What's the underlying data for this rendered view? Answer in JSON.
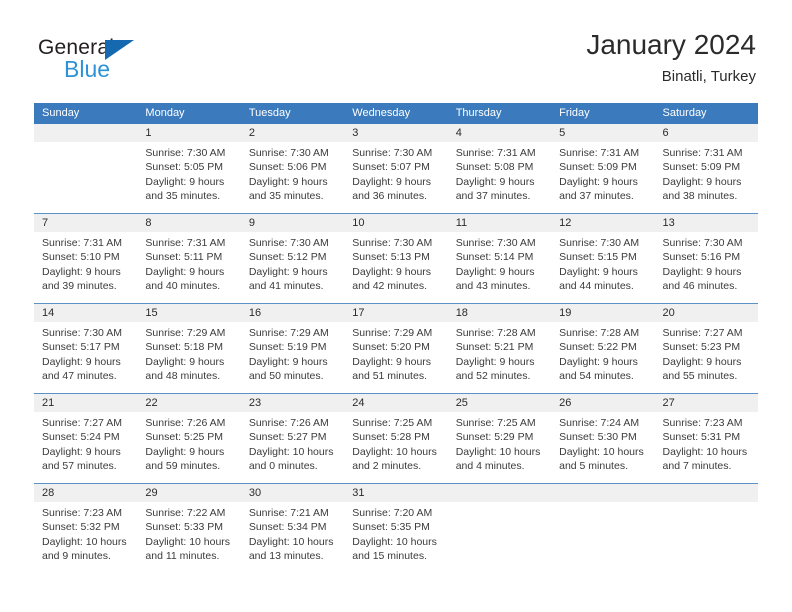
{
  "brand": {
    "name_top": "General",
    "name_bottom": "Blue",
    "triangle_color": "#1569b0",
    "blue_color": "#2e93d6"
  },
  "header": {
    "title": "January 2024",
    "subtitle": "Binatli, Turkey"
  },
  "theme": {
    "header_blue": "#3a7abd",
    "row_divider": "#5b93c9",
    "daynum_band": "#f0f0f0"
  },
  "weekdays": [
    "Sunday",
    "Monday",
    "Tuesday",
    "Wednesday",
    "Thursday",
    "Friday",
    "Saturday"
  ],
  "weeks": [
    [
      {
        "day": "",
        "lines": []
      },
      {
        "day": "1",
        "lines": [
          "Sunrise: 7:30 AM",
          "Sunset: 5:05 PM",
          "Daylight: 9 hours",
          "and 35 minutes."
        ]
      },
      {
        "day": "2",
        "lines": [
          "Sunrise: 7:30 AM",
          "Sunset: 5:06 PM",
          "Daylight: 9 hours",
          "and 35 minutes."
        ]
      },
      {
        "day": "3",
        "lines": [
          "Sunrise: 7:30 AM",
          "Sunset: 5:07 PM",
          "Daylight: 9 hours",
          "and 36 minutes."
        ]
      },
      {
        "day": "4",
        "lines": [
          "Sunrise: 7:31 AM",
          "Sunset: 5:08 PM",
          "Daylight: 9 hours",
          "and 37 minutes."
        ]
      },
      {
        "day": "5",
        "lines": [
          "Sunrise: 7:31 AM",
          "Sunset: 5:09 PM",
          "Daylight: 9 hours",
          "and 37 minutes."
        ]
      },
      {
        "day": "6",
        "lines": [
          "Sunrise: 7:31 AM",
          "Sunset: 5:09 PM",
          "Daylight: 9 hours",
          "and 38 minutes."
        ]
      }
    ],
    [
      {
        "day": "7",
        "lines": [
          "Sunrise: 7:31 AM",
          "Sunset: 5:10 PM",
          "Daylight: 9 hours",
          "and 39 minutes."
        ]
      },
      {
        "day": "8",
        "lines": [
          "Sunrise: 7:31 AM",
          "Sunset: 5:11 PM",
          "Daylight: 9 hours",
          "and 40 minutes."
        ]
      },
      {
        "day": "9",
        "lines": [
          "Sunrise: 7:30 AM",
          "Sunset: 5:12 PM",
          "Daylight: 9 hours",
          "and 41 minutes."
        ]
      },
      {
        "day": "10",
        "lines": [
          "Sunrise: 7:30 AM",
          "Sunset: 5:13 PM",
          "Daylight: 9 hours",
          "and 42 minutes."
        ]
      },
      {
        "day": "11",
        "lines": [
          "Sunrise: 7:30 AM",
          "Sunset: 5:14 PM",
          "Daylight: 9 hours",
          "and 43 minutes."
        ]
      },
      {
        "day": "12",
        "lines": [
          "Sunrise: 7:30 AM",
          "Sunset: 5:15 PM",
          "Daylight: 9 hours",
          "and 44 minutes."
        ]
      },
      {
        "day": "13",
        "lines": [
          "Sunrise: 7:30 AM",
          "Sunset: 5:16 PM",
          "Daylight: 9 hours",
          "and 46 minutes."
        ]
      }
    ],
    [
      {
        "day": "14",
        "lines": [
          "Sunrise: 7:30 AM",
          "Sunset: 5:17 PM",
          "Daylight: 9 hours",
          "and 47 minutes."
        ]
      },
      {
        "day": "15",
        "lines": [
          "Sunrise: 7:29 AM",
          "Sunset: 5:18 PM",
          "Daylight: 9 hours",
          "and 48 minutes."
        ]
      },
      {
        "day": "16",
        "lines": [
          "Sunrise: 7:29 AM",
          "Sunset: 5:19 PM",
          "Daylight: 9 hours",
          "and 50 minutes."
        ]
      },
      {
        "day": "17",
        "lines": [
          "Sunrise: 7:29 AM",
          "Sunset: 5:20 PM",
          "Daylight: 9 hours",
          "and 51 minutes."
        ]
      },
      {
        "day": "18",
        "lines": [
          "Sunrise: 7:28 AM",
          "Sunset: 5:21 PM",
          "Daylight: 9 hours",
          "and 52 minutes."
        ]
      },
      {
        "day": "19",
        "lines": [
          "Sunrise: 7:28 AM",
          "Sunset: 5:22 PM",
          "Daylight: 9 hours",
          "and 54 minutes."
        ]
      },
      {
        "day": "20",
        "lines": [
          "Sunrise: 7:27 AM",
          "Sunset: 5:23 PM",
          "Daylight: 9 hours",
          "and 55 minutes."
        ]
      }
    ],
    [
      {
        "day": "21",
        "lines": [
          "Sunrise: 7:27 AM",
          "Sunset: 5:24 PM",
          "Daylight: 9 hours",
          "and 57 minutes."
        ]
      },
      {
        "day": "22",
        "lines": [
          "Sunrise: 7:26 AM",
          "Sunset: 5:25 PM",
          "Daylight: 9 hours",
          "and 59 minutes."
        ]
      },
      {
        "day": "23",
        "lines": [
          "Sunrise: 7:26 AM",
          "Sunset: 5:27 PM",
          "Daylight: 10 hours",
          "and 0 minutes."
        ]
      },
      {
        "day": "24",
        "lines": [
          "Sunrise: 7:25 AM",
          "Sunset: 5:28 PM",
          "Daylight: 10 hours",
          "and 2 minutes."
        ]
      },
      {
        "day": "25",
        "lines": [
          "Sunrise: 7:25 AM",
          "Sunset: 5:29 PM",
          "Daylight: 10 hours",
          "and 4 minutes."
        ]
      },
      {
        "day": "26",
        "lines": [
          "Sunrise: 7:24 AM",
          "Sunset: 5:30 PM",
          "Daylight: 10 hours",
          "and 5 minutes."
        ]
      },
      {
        "day": "27",
        "lines": [
          "Sunrise: 7:23 AM",
          "Sunset: 5:31 PM",
          "Daylight: 10 hours",
          "and 7 minutes."
        ]
      }
    ],
    [
      {
        "day": "28",
        "lines": [
          "Sunrise: 7:23 AM",
          "Sunset: 5:32 PM",
          "Daylight: 10 hours",
          "and 9 minutes."
        ]
      },
      {
        "day": "29",
        "lines": [
          "Sunrise: 7:22 AM",
          "Sunset: 5:33 PM",
          "Daylight: 10 hours",
          "and 11 minutes."
        ]
      },
      {
        "day": "30",
        "lines": [
          "Sunrise: 7:21 AM",
          "Sunset: 5:34 PM",
          "Daylight: 10 hours",
          "and 13 minutes."
        ]
      },
      {
        "day": "31",
        "lines": [
          "Sunrise: 7:20 AM",
          "Sunset: 5:35 PM",
          "Daylight: 10 hours",
          "and 15 minutes."
        ]
      },
      {
        "day": "",
        "lines": []
      },
      {
        "day": "",
        "lines": []
      },
      {
        "day": "",
        "lines": []
      }
    ]
  ]
}
